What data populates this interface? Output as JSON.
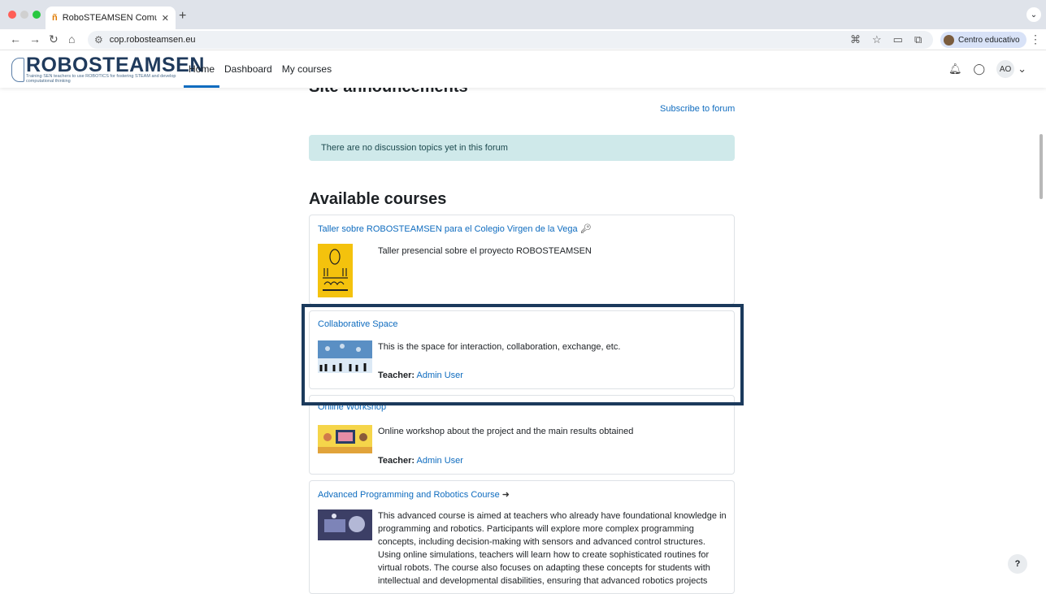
{
  "browser": {
    "tab_title": "RoboSTEAMSEN Comunity of",
    "url": "cop.robosteamsen.eu",
    "profile_name": "Centro educativo"
  },
  "site": {
    "brand": "ROBOSTEAMSEN",
    "tagline": "Training SEN teachers to use ROBOTICS for fostering STEAM and develop computational thinking",
    "nav": [
      "Home",
      "Dashboard",
      "My courses"
    ],
    "user_initials": "AO"
  },
  "announcements": {
    "heading": "Site announcements",
    "subscribe": "Subscribe to forum",
    "empty_message": "There are no discussion topics yet in this forum"
  },
  "courses": {
    "heading": "Available courses",
    "teacher_label": "Teacher:",
    "items": [
      {
        "title": "Taller sobre ROBOSTEAMSEN para el Colegio Virgen de la Vega",
        "summary": "Taller presencial sobre el proyecto ROBOSTEAMSEN",
        "teacher": ""
      },
      {
        "title": "Collaborative Space",
        "summary": "This is the space for interaction, collaboration, exchange, etc.",
        "teacher": "Admin User"
      },
      {
        "title": "Online Workshop",
        "summary": "Online workshop about the project and the main results obtained",
        "teacher": "Admin User"
      },
      {
        "title": "Advanced Programming and Robotics Course",
        "summary": "This advanced course is aimed at teachers who already have foundational knowledge in programming and robotics. Participants will explore more complex programming concepts, including decision-making with sensors and advanced control structures. Using online simulations, teachers will learn how to create sophisticated routines for virtual robots. The course also focuses on adapting these concepts for students with intellectual and developmental disabilities, ensuring that advanced robotics projects",
        "teacher": ""
      }
    ]
  },
  "colors": {
    "accent": "#0f6cbf",
    "highlight_border": "#1b3a5c",
    "alert_bg": "#cfe9ea"
  }
}
